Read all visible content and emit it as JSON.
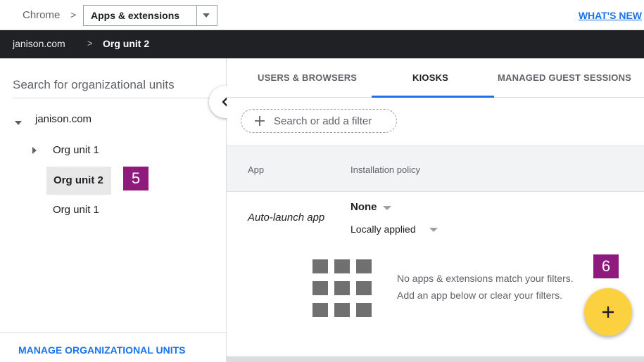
{
  "topbar": {
    "root_label": "Chrome",
    "separator": ">",
    "selected_section": "Apps & extensions",
    "whats_new": "WHAT'S NEW"
  },
  "org_path": {
    "root": "janison.com",
    "separator": ">",
    "current": "Org unit 2"
  },
  "left_panel": {
    "search_placeholder": "Search for organizational units",
    "tree": {
      "root": "janison.com",
      "items": [
        {
          "label": "Org unit 1",
          "expandable": true
        },
        {
          "label": "Org unit 2",
          "selected": true
        },
        {
          "label": "Org unit 1"
        }
      ]
    },
    "manage_link": "MANAGE ORGANIZATIONAL UNITS"
  },
  "tabs": [
    {
      "label": "USERS & BROWSERS"
    },
    {
      "label": "KIOSKS",
      "active": true
    },
    {
      "label": "MANAGED GUEST SESSIONS"
    }
  ],
  "filter": {
    "placeholder": "Search or add a filter"
  },
  "table": {
    "columns": [
      "App",
      "Installation policy"
    ],
    "row": {
      "app": "Auto-launch app",
      "policy_value": "None",
      "policy_source": "Locally applied"
    }
  },
  "empty_state": {
    "line1": "No apps & extensions match your filters.",
    "line2": "Add an app below or clear your filters."
  },
  "callouts": {
    "badge_a": "5",
    "badge_b": "6"
  },
  "colors": {
    "accent": "#1a73e8",
    "org_bar": "#202124",
    "fab": "#fbd13f",
    "callout": "#8e1a7e"
  },
  "icons": {
    "fab": "plus-icon",
    "collapse": "chevron-left-icon",
    "empty": "apps-grid-icon"
  }
}
